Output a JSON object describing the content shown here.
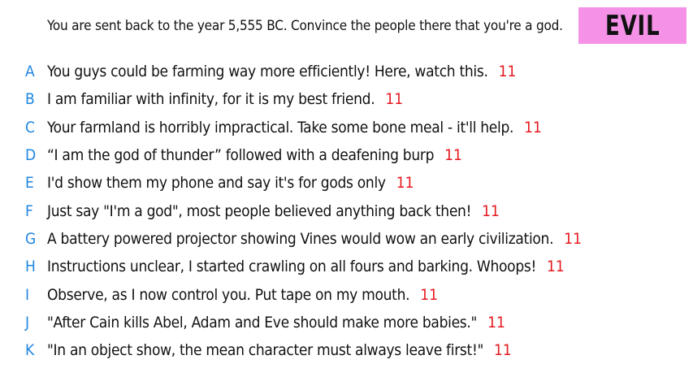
{
  "prompt": "You are sent back to the year 5,555 BC. Convince the people there that you're a god.",
  "badge": "EVIL",
  "colors": {
    "letter": "#1f86e0",
    "score": "#e5191e",
    "badge_bg": "#f592e8"
  },
  "answers": [
    {
      "letter": "A",
      "text": "You guys could be farming way more efficiently! Here, watch this.",
      "score": "11"
    },
    {
      "letter": "B",
      "text": "I am familiar with infinity, for it is my best friend.",
      "score": "11"
    },
    {
      "letter": "C",
      "text": "Your farmland is horribly impractical. Take some bone meal - it'll help.",
      "score": "11"
    },
    {
      "letter": "D",
      "text": "“I am the god of thunder” followed with a deafening burp",
      "score": "11"
    },
    {
      "letter": "E",
      "text": "I'd show them my phone and say it's for gods only",
      "score": "11"
    },
    {
      "letter": "F",
      "text": "Just say \"I'm a god\", most people believed anything back then!",
      "score": "11"
    },
    {
      "letter": "G",
      "text": "A battery powered projector showing Vines would wow an early civilization.",
      "score": "11"
    },
    {
      "letter": "H",
      "text": "Instructions unclear, I started crawling on all fours and barking. Whoops!",
      "score": "11"
    },
    {
      "letter": "I",
      "text": "Observe, as I now control you. Put tape on my mouth.",
      "score": "11"
    },
    {
      "letter": "J",
      "text": "\"After Cain kills Abel, Adam and Eve should make more babies.\"",
      "score": "11"
    },
    {
      "letter": "K",
      "text": "\"In an object show, the mean character must always leave first!\"",
      "score": "11"
    }
  ]
}
